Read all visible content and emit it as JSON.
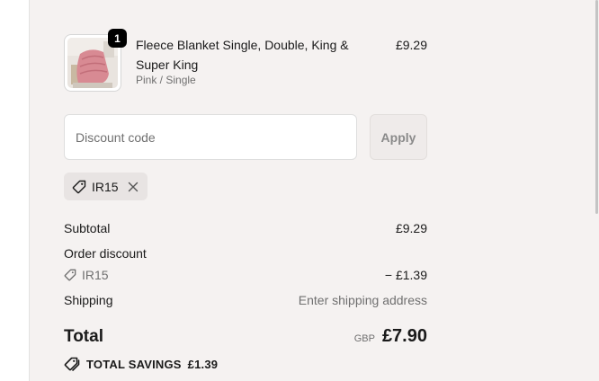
{
  "cart": {
    "items": [
      {
        "name": "Fleece Blanket Single, Double, King & Super King",
        "variant": "Pink / Single",
        "price": "£9.29",
        "quantity": "1",
        "image_icon": "pink-fleece-blanket-photo"
      }
    ]
  },
  "discount": {
    "placeholder": "Discount code",
    "apply_label": "Apply",
    "applied_code": "IR15"
  },
  "summary": {
    "subtotal_label": "Subtotal",
    "subtotal_value": "£9.29",
    "order_discount_label": "Order discount",
    "discount_code": "IR15",
    "discount_value": "− £1.39",
    "shipping_label": "Shipping",
    "shipping_value": "Enter shipping address",
    "total_label": "Total",
    "currency": "GBP",
    "total_value": "£7.90",
    "savings_label": "TOTAL SAVINGS",
    "savings_value": "£1.39"
  },
  "colors": {
    "summary_bg": "#f5f2f1",
    "chip_bg": "#e8e4e3",
    "badge": "#000000",
    "muted_text": "#707070"
  }
}
